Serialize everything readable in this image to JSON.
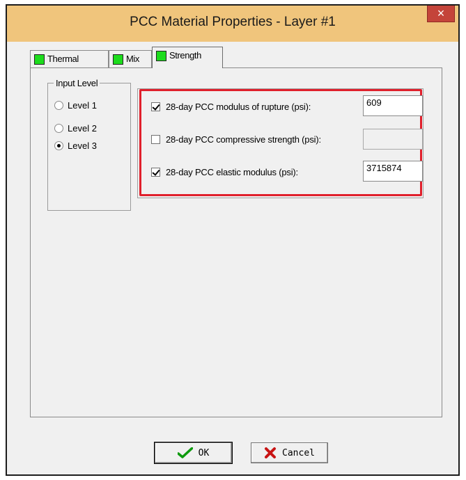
{
  "window": {
    "title": "PCC Material Properties - Layer #1",
    "close_glyph": "×"
  },
  "tabs": [
    {
      "label": "Thermal",
      "indicator_color": "#1ddc1d"
    },
    {
      "label": "Mix",
      "indicator_color": "#1ddc1d"
    },
    {
      "label": "Strength",
      "indicator_color": "#1ddc1d",
      "active": true
    }
  ],
  "input_level": {
    "label": "Input Level",
    "options": [
      {
        "label": "Level 1",
        "selected": false
      },
      {
        "label": "Level 2",
        "selected": false
      },
      {
        "label": "Level 3",
        "selected": true
      }
    ]
  },
  "properties": [
    {
      "label": "28-day PCC modulus of rupture (psi):",
      "checked": true,
      "value": "609"
    },
    {
      "label": "28-day PCC compressive strength (psi):",
      "checked": false,
      "value": ""
    },
    {
      "label": "28-day PCC elastic modulus (psi):",
      "checked": true,
      "value": "3715874"
    }
  ],
  "highlight_color": "#e0202c",
  "buttons": {
    "ok_label": "OK",
    "cancel_label": "Cancel"
  },
  "icons": {
    "ok": "checkmark-icon",
    "cancel": "x-mark-icon",
    "close": "close-icon"
  }
}
